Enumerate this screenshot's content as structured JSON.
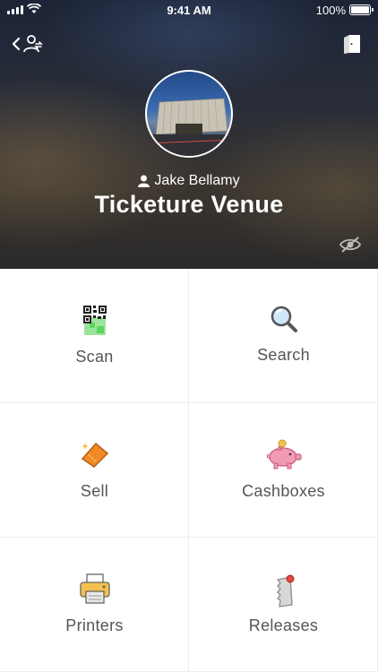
{
  "status_bar": {
    "time": "9:41 AM",
    "battery": "100%",
    "icons": [
      "signal-icon",
      "wifi-icon",
      "battery-icon"
    ]
  },
  "header": {
    "back_icon": "back-chevron-icon",
    "switch_icon": "switch-user-icon",
    "exit_icon": "exit-door-icon",
    "user_icon": "person-icon",
    "user_name": "Jake Bellamy",
    "venue_name": "Ticketure Venue",
    "hide_icon": "eye-slash-icon"
  },
  "menu": [
    {
      "label": "Scan",
      "icon": "qr-code-icon"
    },
    {
      "label": "Search",
      "icon": "magnifier-icon"
    },
    {
      "label": "Sell",
      "icon": "ticket-icon"
    },
    {
      "label": "Cashboxes",
      "icon": "piggy-bank-icon"
    },
    {
      "label": "Printers",
      "icon": "printer-icon"
    },
    {
      "label": "Releases",
      "icon": "release-tag-icon"
    }
  ],
  "colors": {
    "accent_orange": "#f08a24",
    "piggy_pink": "#f19ab4",
    "label_gray": "#555555"
  }
}
